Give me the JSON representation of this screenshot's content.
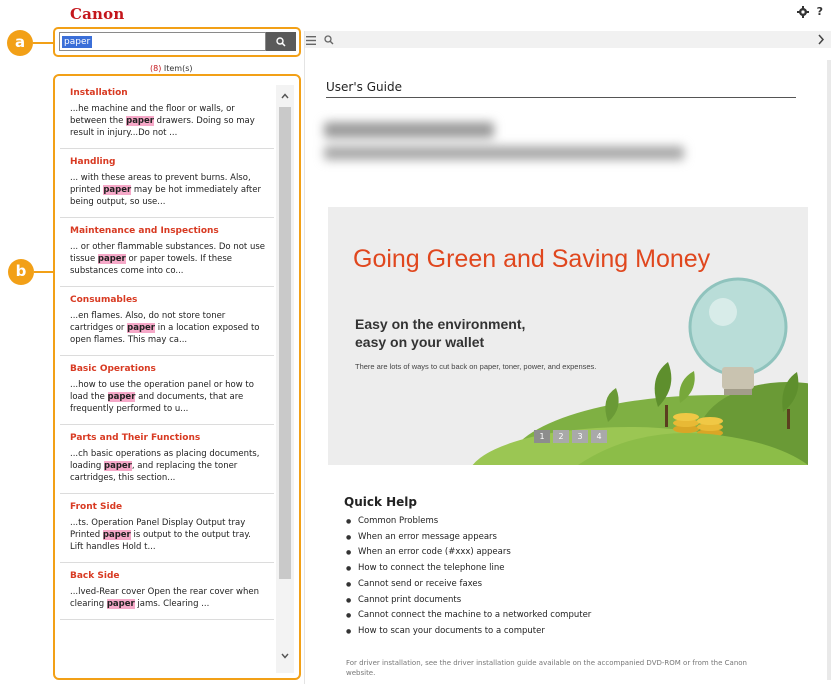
{
  "header": {
    "brand": "Canon",
    "settings_icon": "gear-icon",
    "help_label": "?"
  },
  "callouts": {
    "a": "a",
    "b": "b"
  },
  "search": {
    "value": "paper",
    "button_icon": "search-icon",
    "items_count": "(8)",
    "items_suffix": " Item(s)"
  },
  "results": [
    {
      "title": "Installation",
      "before": "...he machine and the floor or walls, or between the ",
      "term": "paper",
      "after": " drawers. Doing so may result in injury...Do not ..."
    },
    {
      "title": "Handling",
      "before": "... with these areas to prevent burns. Also, printed ",
      "term": "paper",
      "after": " may be hot immediately after being output, so use..."
    },
    {
      "title": "Maintenance and Inspections",
      "before": "... or other flammable substances. Do not use tissue ",
      "term": "paper",
      "after": " or paper towels. If these substances come into co..."
    },
    {
      "title": "Consumables",
      "before": "...en flames. Also, do not store toner cartridges or ",
      "term": "paper",
      "after": " in a location exposed to open flames. This may ca..."
    },
    {
      "title": "Basic Operations",
      "before": "...how to use the operation panel or how to load the ",
      "term": "paper",
      "after": " and documents, that are frequently performed to u..."
    },
    {
      "title": "Parts and Their Functions",
      "before": "...ch basic operations as placing documents, loading ",
      "term": "paper",
      "after": ", and replacing the toner cartridges, this section..."
    },
    {
      "title": "Front Side",
      "before": "...ts. Operation Panel Display Output tray Printed ",
      "term": "paper",
      "after": " is output to the output tray. Lift handles Hold t..."
    },
    {
      "title": "Back Side",
      "before": "...lved-Rear cover Open the rear cover when clearing ",
      "term": "paper",
      "after": " jams. Clearing ..."
    }
  ],
  "content": {
    "guide_title": "User's Guide",
    "banner": {
      "title": "Going Green and Saving Money",
      "subtitle_1": "Easy on the environment,",
      "subtitle_2": "easy on your wallet",
      "body": "There are lots of ways to cut back on paper, toner, power, and expenses.",
      "dots": [
        "1",
        "2",
        "3",
        "4"
      ]
    },
    "quick_help": {
      "title": "Quick Help",
      "items": [
        "Common Problems",
        "When an error message appears",
        "When an error code (#xxx) appears",
        "How to connect the telephone line",
        "Cannot send or receive faxes",
        "Cannot print documents",
        "Cannot connect the machine to a networked computer",
        "How to scan your documents to a computer"
      ]
    },
    "footnote": "For driver installation, see the driver installation guide available on the accompanied DVD-ROM or from the Canon website."
  },
  "colors": {
    "brand": "#c4161c",
    "callout": "#f2a017",
    "result_title": "#d83a22",
    "highlight": "#f6a8c8",
    "banner_title": "#e0471e"
  }
}
